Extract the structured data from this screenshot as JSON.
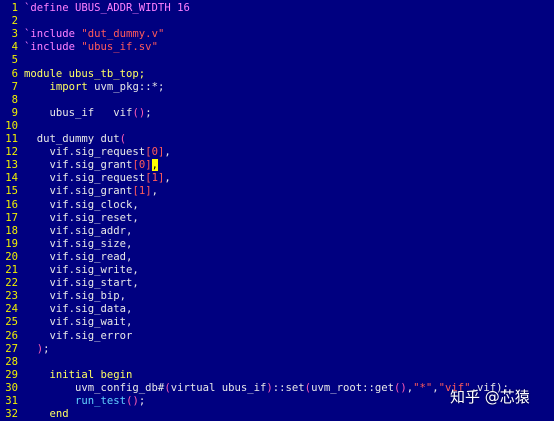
{
  "editor": {
    "lines": [
      {
        "n": "1",
        "segs": [
          {
            "t": "`define UBUS_ADDR_WIDTH 16",
            "c": "pre"
          }
        ]
      },
      {
        "n": "2",
        "segs": []
      },
      {
        "n": "3",
        "segs": [
          {
            "t": "`include ",
            "c": "pre"
          },
          {
            "t": "\"dut_dummy.v\"",
            "c": "str"
          }
        ]
      },
      {
        "n": "4",
        "segs": [
          {
            "t": "`include ",
            "c": "pre"
          },
          {
            "t": "\"ubus_if.sv\"",
            "c": "str"
          }
        ]
      },
      {
        "n": "5",
        "segs": []
      },
      {
        "n": "6",
        "segs": [
          {
            "t": "module ubus_tb_top;",
            "c": "kw"
          }
        ]
      },
      {
        "n": "7",
        "segs": [
          {
            "t": "    ",
            "c": "id"
          },
          {
            "t": "import",
            "c": "kw"
          },
          {
            "t": " uvm_pkg::*;",
            "c": "id"
          }
        ]
      },
      {
        "n": "8",
        "segs": []
      },
      {
        "n": "9",
        "segs": [
          {
            "t": "    ubus_if   vif",
            "c": "id"
          },
          {
            "t": "()",
            "c": "paren"
          },
          {
            "t": ";",
            "c": "id"
          }
        ]
      },
      {
        "n": "10",
        "segs": []
      },
      {
        "n": "11",
        "segs": [
          {
            "t": "  dut_dummy dut",
            "c": "id"
          },
          {
            "t": "(",
            "c": "paren"
          }
        ]
      },
      {
        "n": "12",
        "segs": [
          {
            "t": "    vif.sig_request",
            "c": "id"
          },
          {
            "t": "[0]",
            "c": "num"
          },
          {
            "t": ",",
            "c": "id"
          }
        ]
      },
      {
        "n": "13",
        "segs": [
          {
            "t": "    vif.sig_grant",
            "c": "id"
          },
          {
            "t": "[0]",
            "c": "num"
          },
          {
            "t": ",",
            "c": "cursor"
          }
        ]
      },
      {
        "n": "14",
        "segs": [
          {
            "t": "    vif.sig_request",
            "c": "id"
          },
          {
            "t": "[1]",
            "c": "num"
          },
          {
            "t": ",",
            "c": "id"
          }
        ]
      },
      {
        "n": "15",
        "segs": [
          {
            "t": "    vif.sig_grant",
            "c": "id"
          },
          {
            "t": "[1]",
            "c": "num"
          },
          {
            "t": ",",
            "c": "id"
          }
        ]
      },
      {
        "n": "16",
        "segs": [
          {
            "t": "    vif.sig_clock,",
            "c": "id"
          }
        ]
      },
      {
        "n": "17",
        "segs": [
          {
            "t": "    vif.sig_reset,",
            "c": "id"
          }
        ]
      },
      {
        "n": "18",
        "segs": [
          {
            "t": "    vif.sig_addr,",
            "c": "id"
          }
        ]
      },
      {
        "n": "19",
        "segs": [
          {
            "t": "    vif.sig_size,",
            "c": "id"
          }
        ]
      },
      {
        "n": "20",
        "segs": [
          {
            "t": "    vif.sig_read,",
            "c": "id"
          }
        ]
      },
      {
        "n": "21",
        "segs": [
          {
            "t": "    vif.sig_write,",
            "c": "id"
          }
        ]
      },
      {
        "n": "22",
        "segs": [
          {
            "t": "    vif.sig_start,",
            "c": "id"
          }
        ]
      },
      {
        "n": "23",
        "segs": [
          {
            "t": "    vif.sig_bip,",
            "c": "id"
          }
        ]
      },
      {
        "n": "24",
        "segs": [
          {
            "t": "    vif.sig_data,",
            "c": "id"
          }
        ]
      },
      {
        "n": "25",
        "segs": [
          {
            "t": "    vif.sig_wait,",
            "c": "id"
          }
        ]
      },
      {
        "n": "26",
        "segs": [
          {
            "t": "    vif.sig_error",
            "c": "id"
          }
        ]
      },
      {
        "n": "27",
        "segs": [
          {
            "t": "  ",
            "c": "id"
          },
          {
            "t": ")",
            "c": "paren"
          },
          {
            "t": ";",
            "c": "id"
          }
        ]
      },
      {
        "n": "28",
        "segs": []
      },
      {
        "n": "29",
        "segs": [
          {
            "t": "    ",
            "c": "id"
          },
          {
            "t": "initial begin",
            "c": "kw"
          }
        ]
      },
      {
        "n": "30",
        "segs": [
          {
            "t": "        uvm_config_db#",
            "c": "id"
          },
          {
            "t": "(",
            "c": "paren"
          },
          {
            "t": "virtual ubus_if",
            "c": "id"
          },
          {
            "t": ")",
            "c": "paren"
          },
          {
            "t": "::set",
            "c": "id"
          },
          {
            "t": "(",
            "c": "paren"
          },
          {
            "t": "uvm_root::get",
            "c": "id"
          },
          {
            "t": "()",
            "c": "paren"
          },
          {
            "t": ",",
            "c": "id"
          },
          {
            "t": "\"*\"",
            "c": "str"
          },
          {
            "t": ",",
            "c": "id"
          },
          {
            "t": "\"vif\"",
            "c": "str"
          },
          {
            "t": ",vif);",
            "c": "id"
          }
        ]
      },
      {
        "n": "31",
        "segs": [
          {
            "t": "        ",
            "c": "id"
          },
          {
            "t": "run_test",
            "c": "fn"
          },
          {
            "t": "()",
            "c": "paren"
          },
          {
            "t": ";",
            "c": "id"
          }
        ]
      },
      {
        "n": "32",
        "segs": [
          {
            "t": "    ",
            "c": "id"
          },
          {
            "t": "end",
            "c": "kw"
          }
        ]
      }
    ]
  },
  "watermark": "知乎 @芯猿"
}
